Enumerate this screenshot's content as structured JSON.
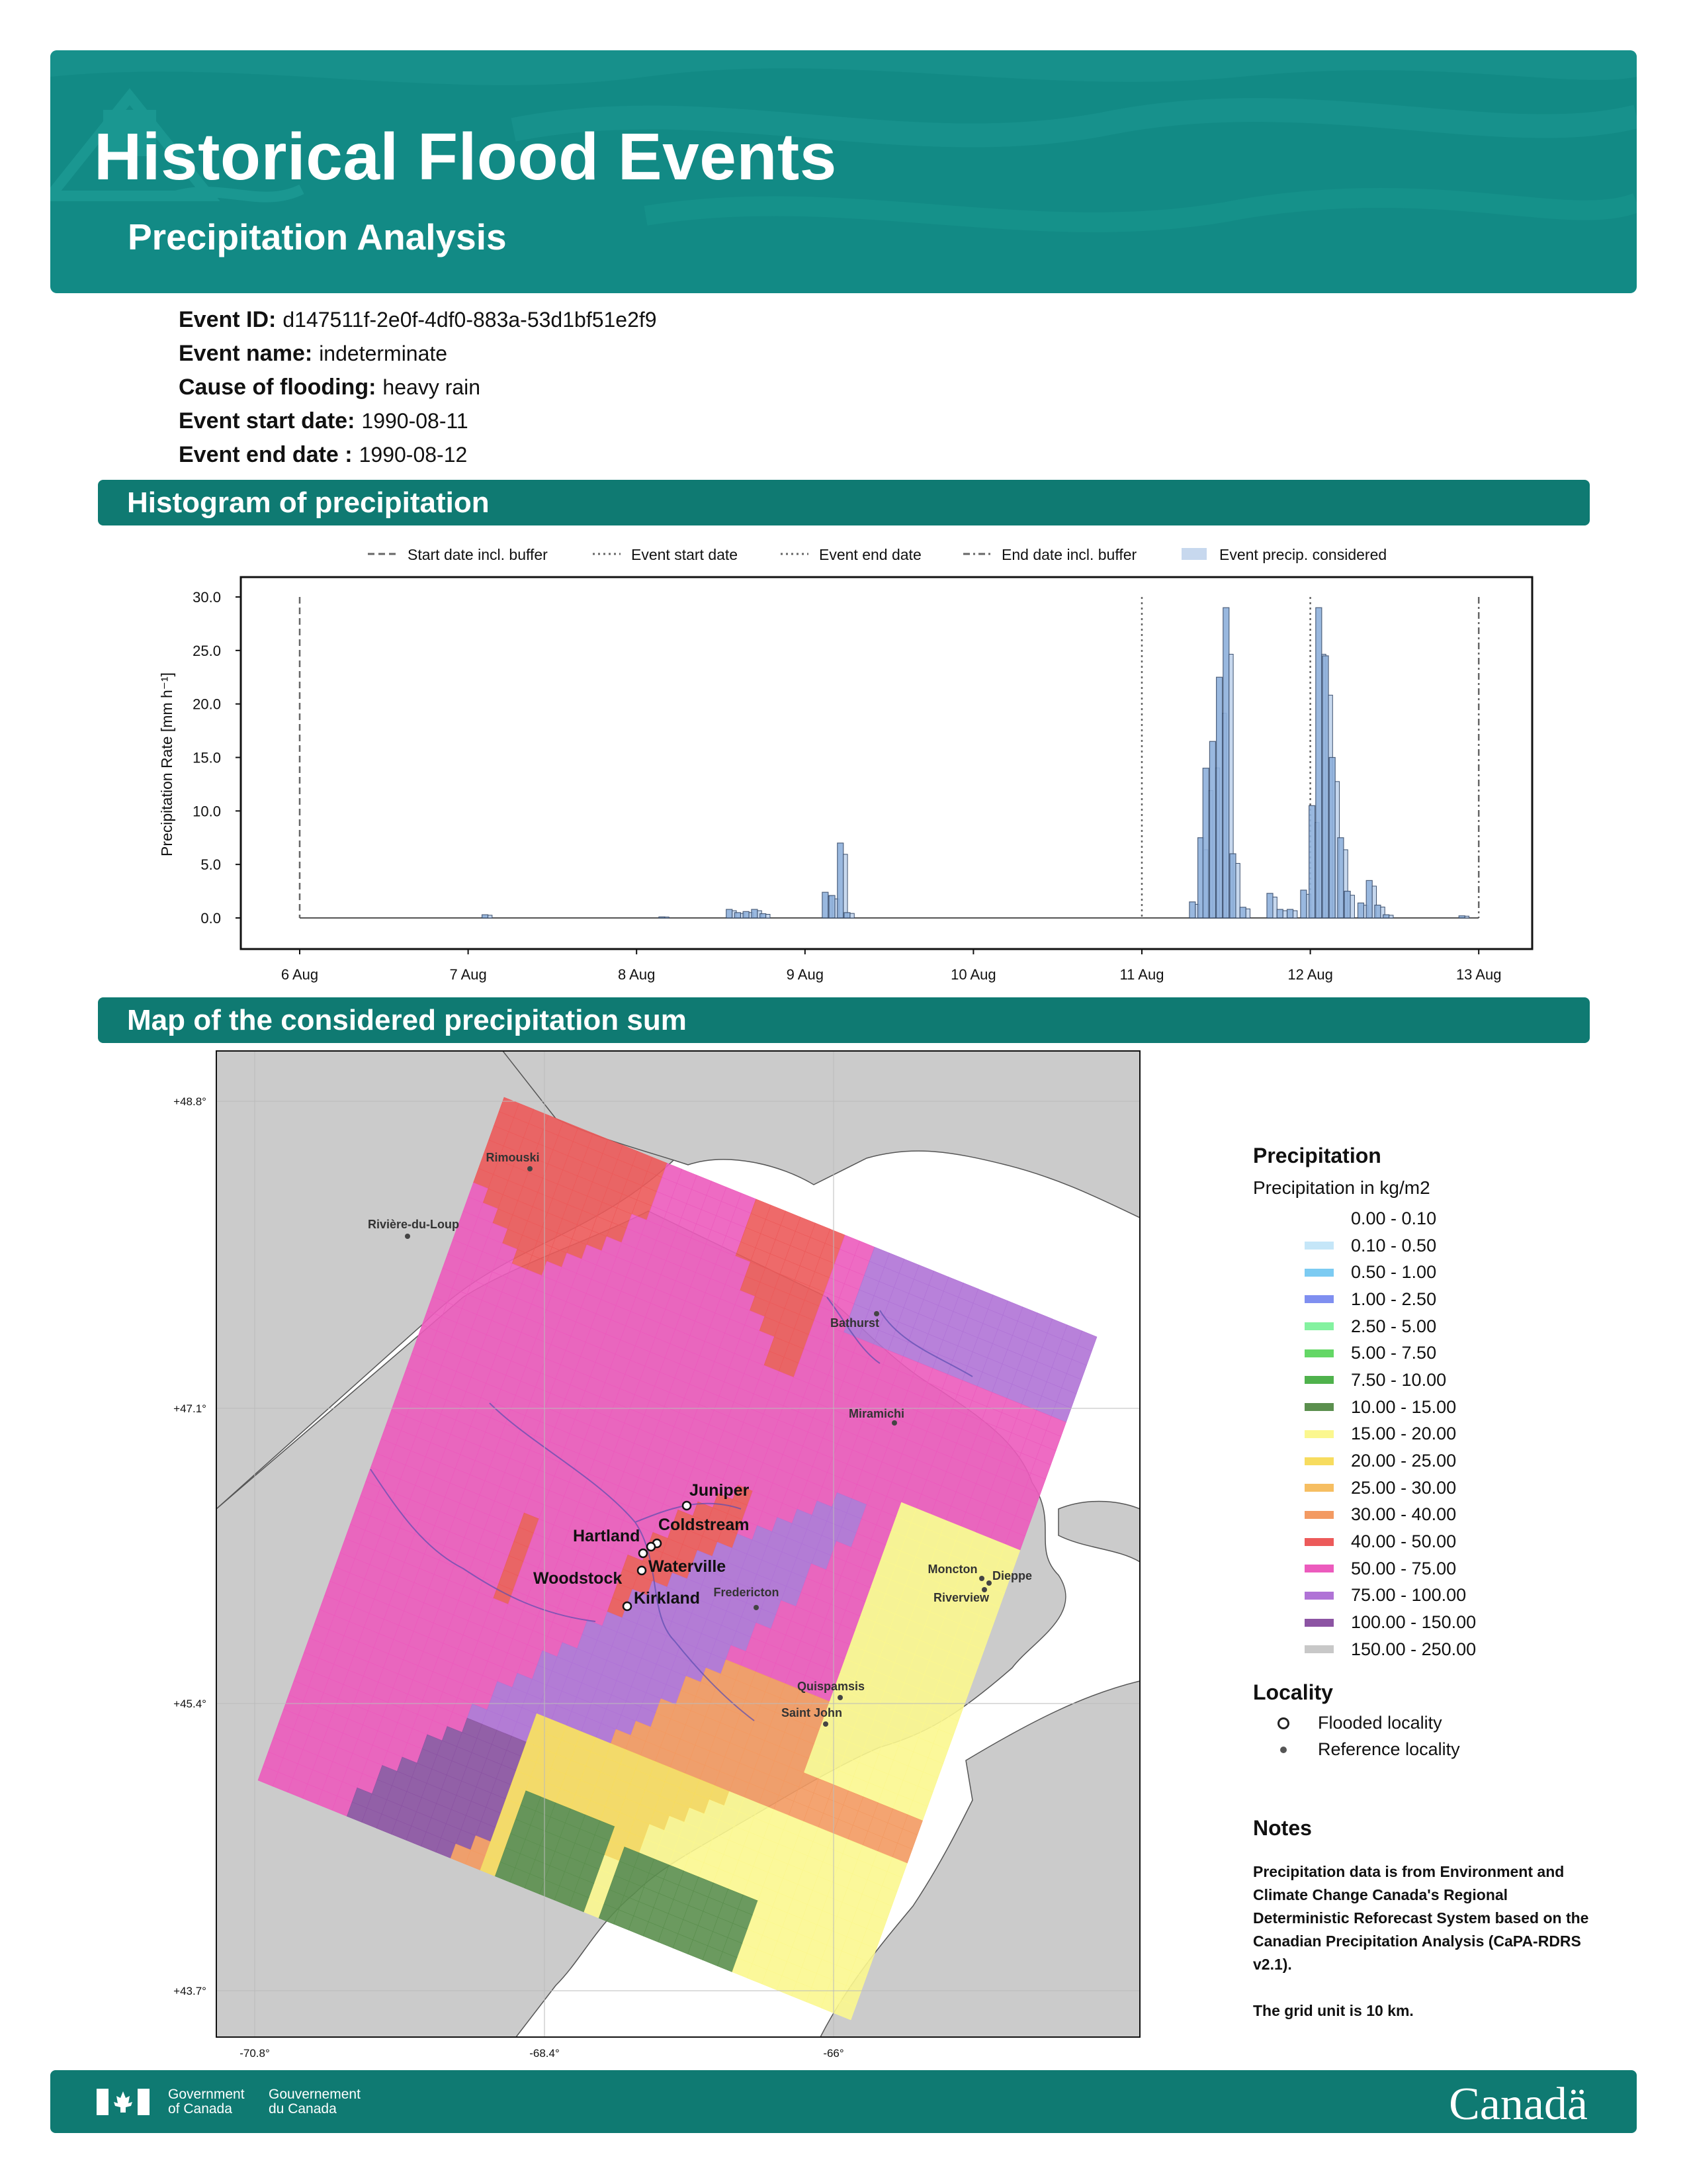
{
  "header": {
    "title": "Historical Flood Events",
    "subtitle": "Precipitation Analysis"
  },
  "event": {
    "id_label": "Event ID:",
    "id_value": "d147511f-2e0f-4df0-883a-53d1bf51e2f9",
    "name_label": "Event name:",
    "name_value": "indeterminate",
    "cause_label": "Cause of flooding:",
    "cause_value": "heavy rain",
    "start_label": "Event start date:",
    "start_value": "1990-08-11",
    "end_label": "Event end date :",
    "end_value": "1990-08-12"
  },
  "sections": {
    "histogram": "Histogram of precipitation",
    "map": "Map of the considered precipitation sum"
  },
  "chart_data": {
    "type": "bar",
    "ylabel": "Precipitation Rate [mm h⁻¹]",
    "ylim": [
      0,
      30
    ],
    "yticks": [
      "0.0",
      "5.0",
      "10.0",
      "15.0",
      "20.0",
      "25.0",
      "30.0"
    ],
    "xticks": [
      "6 Aug",
      "7 Aug",
      "8 Aug",
      "9 Aug",
      "10 Aug",
      "11 Aug",
      "12 Aug",
      "13 Aug"
    ],
    "grid": false,
    "legend_position": "top",
    "legend": [
      {
        "label": "Start date incl. buffer",
        "style": "dashed"
      },
      {
        "label": "Event start date",
        "style": "dotted"
      },
      {
        "label": "Event end date",
        "style": "dotted"
      },
      {
        "label": "End date incl. buffer",
        "style": "dashdot"
      },
      {
        "label": "Event precip. considered",
        "style": "patch"
      }
    ],
    "vlines_day": {
      "start_buffer": 0,
      "event_start": 5,
      "event_end": 6,
      "end_buffer": 7
    },
    "series": [
      {
        "day": 1.1,
        "value": 0.3
      },
      {
        "day": 2.15,
        "value": 0.1
      },
      {
        "day": 2.55,
        "value": 0.8
      },
      {
        "day": 2.6,
        "value": 0.5
      },
      {
        "day": 2.65,
        "value": 0.6
      },
      {
        "day": 2.7,
        "value": 0.8
      },
      {
        "day": 2.75,
        "value": 0.4
      },
      {
        "day": 3.12,
        "value": 2.4
      },
      {
        "day": 3.16,
        "value": 2.1
      },
      {
        "day": 3.21,
        "value": 7.0
      },
      {
        "day": 3.25,
        "value": 0.5
      },
      {
        "day": 5.3,
        "value": 1.5
      },
      {
        "day": 5.35,
        "value": 7.5
      },
      {
        "day": 5.38,
        "value": 14.0
      },
      {
        "day": 5.42,
        "value": 16.5
      },
      {
        "day": 5.46,
        "value": 22.5
      },
      {
        "day": 5.5,
        "value": 29.0
      },
      {
        "day": 5.54,
        "value": 6.0
      },
      {
        "day": 5.6,
        "value": 1.0
      },
      {
        "day": 5.76,
        "value": 2.3
      },
      {
        "day": 5.82,
        "value": 0.8
      },
      {
        "day": 5.88,
        "value": 0.8
      },
      {
        "day": 5.96,
        "value": 2.6
      },
      {
        "day": 6.01,
        "value": 10.5
      },
      {
        "day": 6.05,
        "value": 29.0
      },
      {
        "day": 6.09,
        "value": 24.5
      },
      {
        "day": 6.13,
        "value": 15.0
      },
      {
        "day": 6.18,
        "value": 7.5
      },
      {
        "day": 6.22,
        "value": 2.5
      },
      {
        "day": 6.3,
        "value": 1.4
      },
      {
        "day": 6.35,
        "value": 3.5
      },
      {
        "day": 6.4,
        "value": 1.2
      },
      {
        "day": 6.45,
        "value": 0.3
      },
      {
        "day": 6.9,
        "value": 0.2
      }
    ]
  },
  "map": {
    "lat_labels": [
      "+48.8°",
      "+47.1°",
      "+45.4°",
      "+43.7°"
    ],
    "lon_labels": [
      "-70.8°",
      "-68.4°",
      "-66°"
    ],
    "flooded_localities": [
      "Juniper",
      "Coldstream",
      "Hartland",
      "Waterville",
      "Woodstock",
      "Kirkland"
    ],
    "reference_localities": [
      "Rimouski",
      "Rivière-du-Loup",
      "Bathurst",
      "Miramichi",
      "Moncton",
      "Dieppe",
      "Riverview",
      "Fredericton",
      "Quispamsis",
      "Saint John"
    ]
  },
  "legend": {
    "title": "Precipitation",
    "subtitle": "Precipitation in kg/m2",
    "items": [
      {
        "label": "0.00 - 0.10",
        "color": "#ffffff"
      },
      {
        "label": "0.10 - 0.50",
        "color": "#c5e6f8"
      },
      {
        "label": "0.50 - 1.00",
        "color": "#7ccbf2"
      },
      {
        "label": "1.00 - 2.50",
        "color": "#7f8ff0"
      },
      {
        "label": "2.50 - 5.00",
        "color": "#84f2a0"
      },
      {
        "label": "5.00 - 7.50",
        "color": "#64d766"
      },
      {
        "label": "7.50 - 10.00",
        "color": "#4fb24c"
      },
      {
        "label": "10.00 - 15.00",
        "color": "#5b8f4e"
      },
      {
        "label": "15.00 - 20.00",
        "color": "#fbf78f"
      },
      {
        "label": "20.00 - 25.00",
        "color": "#f7dc5f"
      },
      {
        "label": "25.00 - 30.00",
        "color": "#f6be62"
      },
      {
        "label": "30.00 - 40.00",
        "color": "#f39a62"
      },
      {
        "label": "40.00 - 50.00",
        "color": "#ec5a5a"
      },
      {
        "label": "50.00 - 75.00",
        "color": "#ec5bbd"
      },
      {
        "label": "75.00 - 100.00",
        "color": "#b073d6"
      },
      {
        "label": "100.00 - 150.00",
        "color": "#8c54a3"
      },
      {
        "label": "150.00 - 250.00",
        "color": "#c8c8c8"
      }
    ],
    "locality_title": "Locality",
    "flooded_label": "Flooded locality",
    "reference_label": "Reference locality"
  },
  "notes": {
    "title": "Notes",
    "text1": "Precipitation data is from Environment and Climate Change Canada's Regional Deterministic Reforecast System based on the Canadian Precipitation Analysis (CaPA-RDRS v2.1).",
    "text2": "The grid unit is 10 km."
  },
  "footer": {
    "gov_en": "Government of Canada",
    "gov_fr": "Gouvernement du Canada",
    "wordmark": "Canadä"
  }
}
